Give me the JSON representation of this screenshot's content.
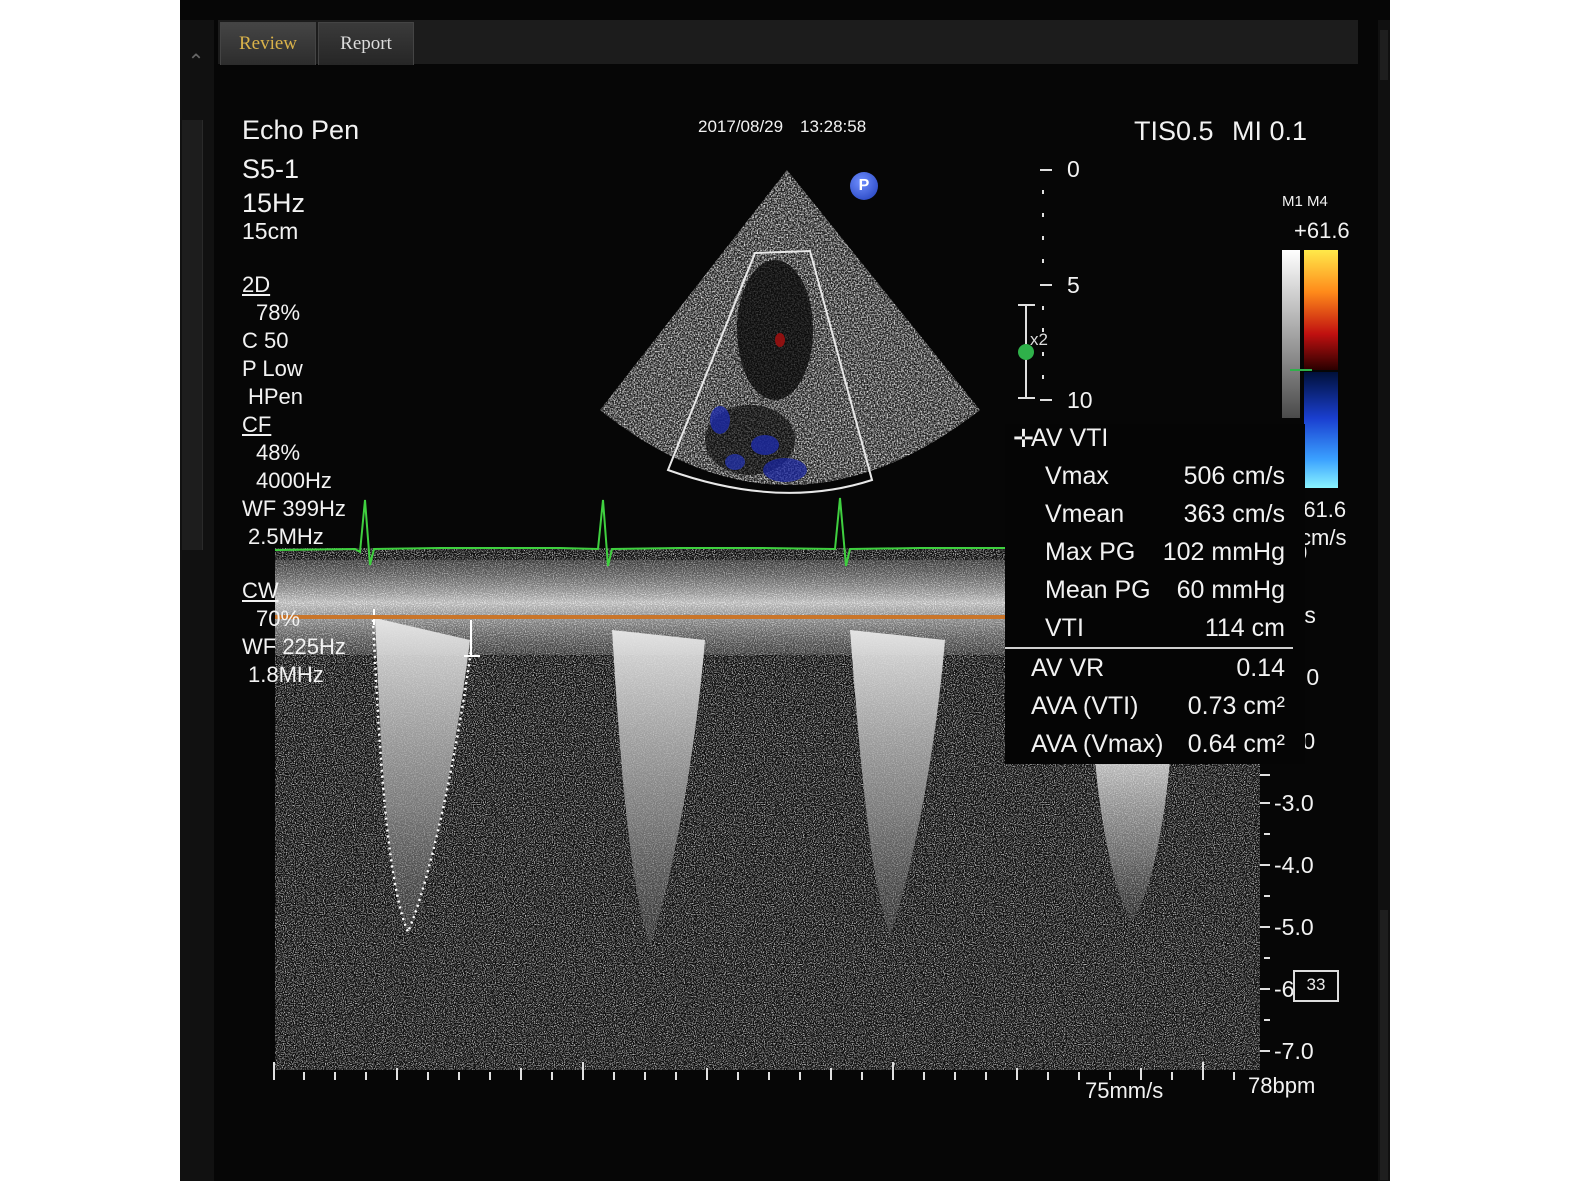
{
  "tabs": [
    {
      "label": "Review",
      "active": true
    },
    {
      "label": "Report",
      "active": false
    }
  ],
  "header": {
    "preset": "Echo Pen",
    "probe": "S5-1",
    "frame_rate": "15Hz",
    "depth": "15cm",
    "date": "2017/08/29",
    "time": "13:28:58",
    "tis": "TIS0.5",
    "mi": "MI 0.1"
  },
  "params": {
    "mode_2d": "2D",
    "gain_2d": "78%",
    "c": "C 50",
    "p": "P Low",
    "hpen": "HPen",
    "mode_cf": "CF",
    "gain_cf": "48%",
    "prf_cf": "4000Hz",
    "wf_cf": "WF 399Hz",
    "freq_cf": "2.5MHz",
    "mode_cw": "CW",
    "gain_cw": "70%",
    "wf_cw": "WF 225Hz",
    "freq_cw": "1.8MHz"
  },
  "depth_scale": [
    "0",
    "5",
    "10"
  ],
  "zoom_marker": "x2",
  "color_scale": {
    "mode": "M1 M4",
    "top": "+61.6",
    "bottom": "-61.6",
    "unit": "cm/s",
    "zero": "0"
  },
  "measurements": {
    "title": "AV VTI",
    "rows": [
      {
        "label": "Vmax",
        "value": "506 cm/s"
      },
      {
        "label": "Vmean",
        "value": "363 cm/s"
      },
      {
        "label": "Max PG",
        "value": "102 mmHg"
      },
      {
        "label": "Mean PG",
        "value": "60 mmHg"
      },
      {
        "label": "VTI",
        "value": "114 cm"
      }
    ],
    "derived": [
      {
        "label": "AV VR",
        "value": "0.14"
      },
      {
        "label": "AVA (VTI)",
        "value": "0.73 cm²"
      },
      {
        "label": "AVA (Vmax)",
        "value": "0.64 cm²"
      }
    ]
  },
  "velocity_scale": {
    "unit_partial": "/s",
    "labels": [
      ".0",
      ".0",
      "-3.0",
      "-4.0",
      "-5.0",
      "-6",
      "-7.0"
    ]
  },
  "scale_box": "33",
  "sweep_speed": "75mm/s",
  "heart_rate": "78bpm",
  "colors": {
    "ecg": "#3fd03f",
    "baseline": "#c9752a",
    "active_tab": "#d9b24a"
  }
}
